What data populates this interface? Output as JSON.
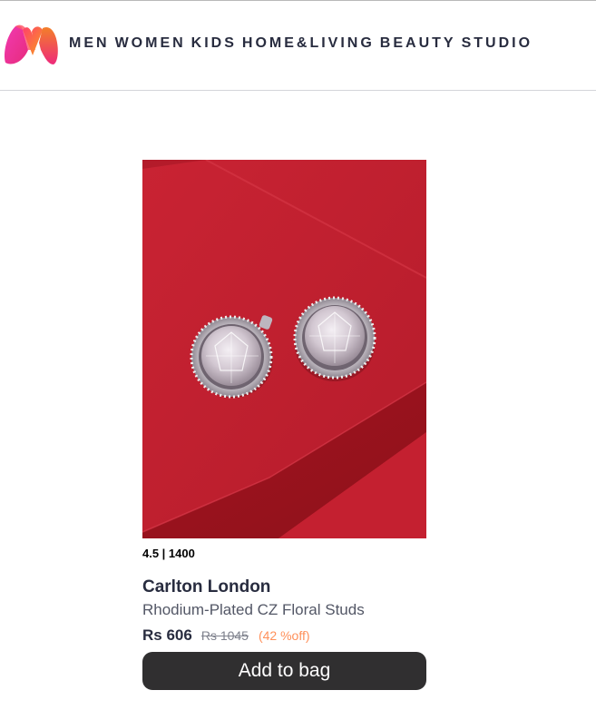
{
  "header": {
    "logo_name": "myntra-logo",
    "nav": [
      {
        "label": "MEN"
      },
      {
        "label": "WOMEN"
      },
      {
        "label": "KIDS"
      },
      {
        "label": "HOME&LIVING"
      },
      {
        "label": "BEAUTY"
      },
      {
        "label": "STUDIO"
      }
    ]
  },
  "product": {
    "rating": "4.5 | 1400",
    "brand": "Carlton London",
    "name": "Rhodium-Plated CZ Floral Studs",
    "price": "Rs 606",
    "mrp": "Rs 1045",
    "discount": "(42 %off)",
    "add_to_bag_label": "Add to bag"
  },
  "colors": {
    "text_primary": "#282c3f",
    "text_secondary": "#535766",
    "discount": "#ff905a",
    "button_bg": "#302f30",
    "image_bg": "#b81d2c",
    "logo_pink": "#e72b7c",
    "logo_orange": "#f89c1c"
  }
}
